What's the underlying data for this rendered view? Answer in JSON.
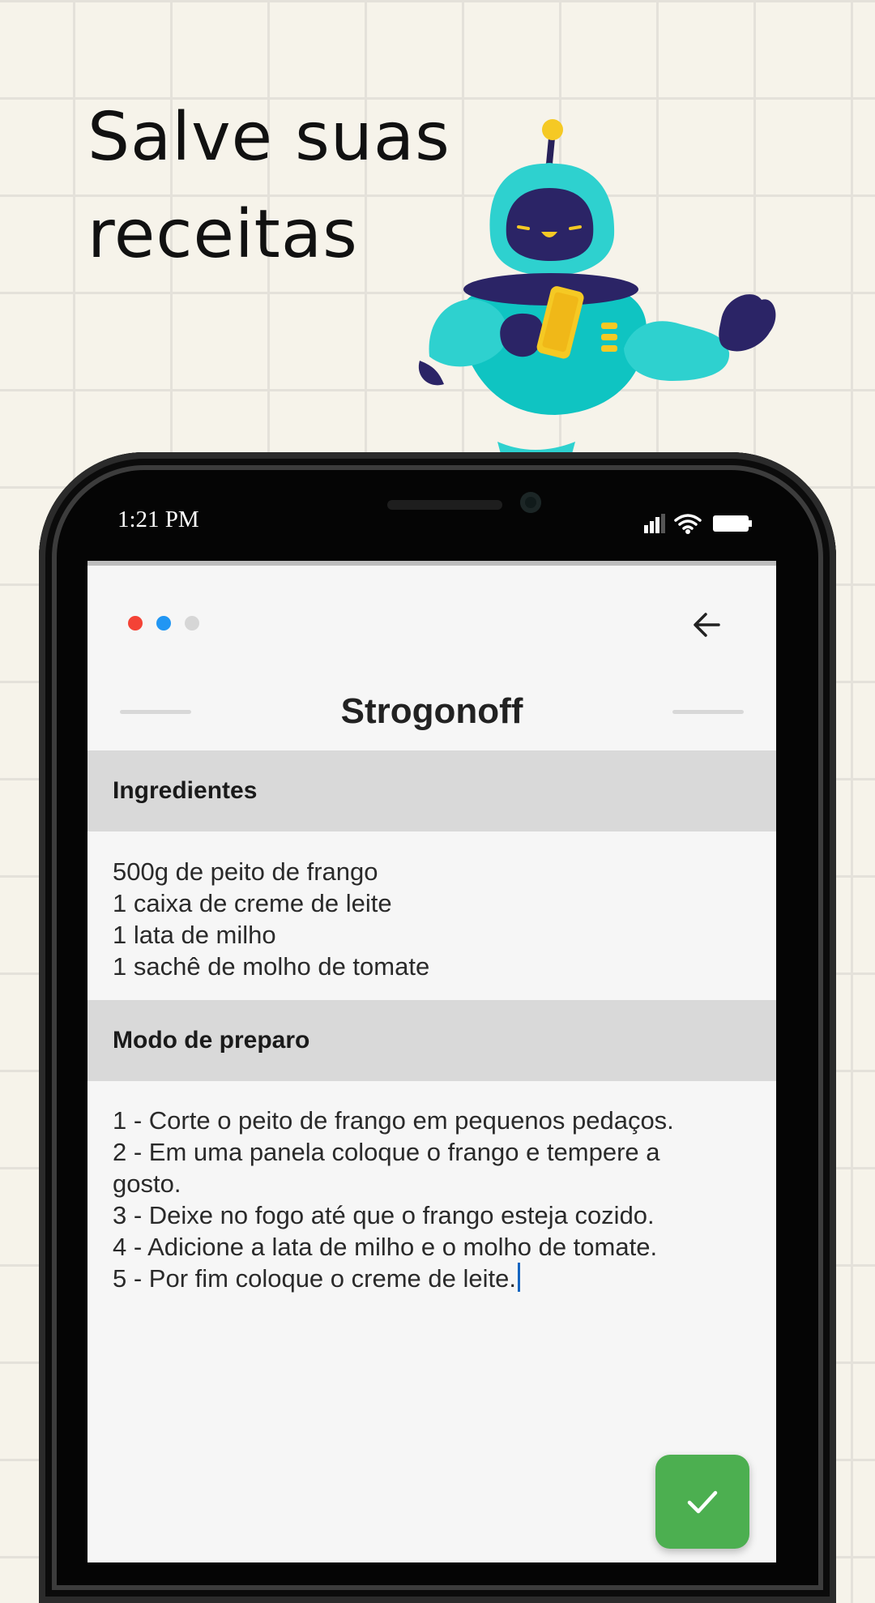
{
  "promo": {
    "headline_line1": "Salve suas",
    "headline_line2": "receitas"
  },
  "status_bar": {
    "time": "1:21 PM",
    "icons": [
      "signal-icon",
      "wifi-icon",
      "battery-icon"
    ]
  },
  "app": {
    "dots": [
      {
        "name": "red-dot",
        "color": "#f44336"
      },
      {
        "name": "blue-dot",
        "color": "#2196f3"
      },
      {
        "name": "gray-dot",
        "color": "#d6d6d6"
      }
    ],
    "back_icon": "arrow-left-icon",
    "recipe_title": "Strogonoff",
    "ingredients": {
      "header": "Ingredientes",
      "lines": [
        "500g de peito de frango",
        "1 caixa de creme de leite",
        "1 lata de milho",
        "1 sachê de molho de tomate"
      ]
    },
    "preparation": {
      "header": "Modo de preparo",
      "lines": [
        "1 - Corte o peito de frango em pequenos pedaços.",
        "2 - Em uma panela coloque o frango e tempere a",
        "gosto.",
        "3 - Deixe no fogo até que o frango esteja cozido.",
        "4 - Adicione a lata de milho e o molho de tomate.",
        "5 - Por fim coloque o creme de leite."
      ]
    },
    "save_icon": "check-icon",
    "accent_color": "#4caf50"
  }
}
